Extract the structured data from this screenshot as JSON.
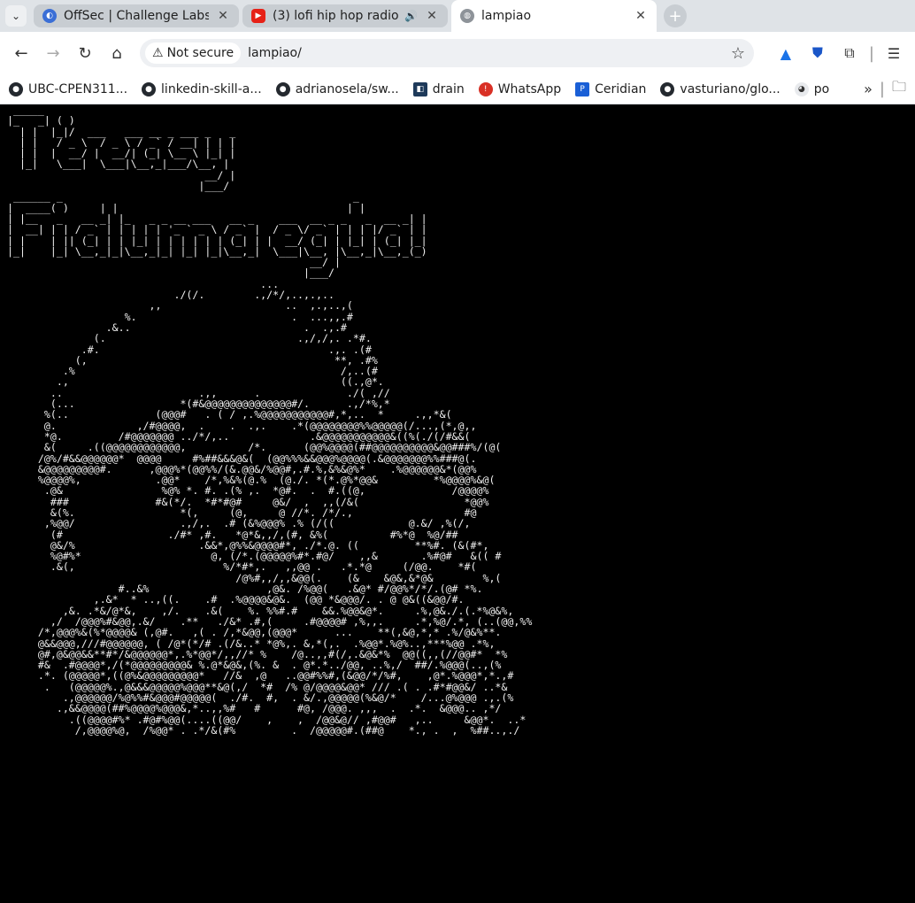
{
  "browser": {
    "tabs": [
      {
        "title": "OffSec | Challenge Labs",
        "active": false
      },
      {
        "title": "(3) lofi hip hop radio 📚",
        "active": false
      },
      {
        "title": "lampiao",
        "active": true
      }
    ],
    "address": {
      "security_label": "Not secure",
      "url": "lampiao/"
    },
    "bookmarks": [
      {
        "label": "UBC-CPEN311..."
      },
      {
        "label": "linkedin-skill-a..."
      },
      {
        "label": "adrianosela/sw..."
      },
      {
        "label": "drain"
      },
      {
        "label": "WhatsApp"
      },
      {
        "label": "Ceridian"
      },
      {
        "label": "vasturiano/glo..."
      },
      {
        "label": "po"
      }
    ]
  },
  "page": {
    "ascii_art": " _____                      \n|_   _| ( )                  \n  | |  |_|/  ___   ___ __ _ ___ _   _\n  | |   / _ \\  / _ \\ / _` / __| | | |\n  | |  |  __/ |  __/| (_| \\__ \\ |_| |\n  |_|   \\___|  \\___|\\__,_|___/\\__, |\n                                __/ |\n                               |___/ \n ______ _                                               _ \n|  ____( )     | |                                     | |\n| |__   _   __ _| |_   _ _ __ ___   __ _    ___  __ _ _   _  __ _| |\n|  __| | | / _` | | | | | '_ ` _ \\ / _` |  / _ \\/ _` | | | |/ _` | |\n| |    | || (_| | | |_| | | | | | | (_| | |  __/ (_| | |_| | (_| |_|\n|_|    |_| \\__,_|_|\\__,_|_| |_| |_|\\__,_|  \\___|\\__, |\\__,_|\\__,_(_)\n                                                 __/ |\n                                                |___/ \n                                         ...\n                           ./(/.        .,/*/,..,.,..\n                       ,,                    ..  ,.,..,(\n                   %.                         .  ...,,.#\n                .&..                            .  .,.#\n              (.                               .,/,/,. .*#.\n            .#.                                     .,. .(#\n           (,                                        **, .#%\n         .%                                           /,..(#\n        .,                                            ((.,@*.\n       ..                      .,,      .              ./( ,//\n       (...                 *(#&@@@@@@@@@@@@@@#/.      .,/*%,*\n      %(..              (@@@#   . ( / ,.%@@@@@@@@@@@#,*,..  *     .,,*&(\n      @.             ,/#@@@@,  .    .  .,.    .*(@@@@@@@@%%@@@@@(/...,(*,@,,\n      *@.         /#@@@@@@@ ../*/,..             .&@@@@@@@@@@@&((%(./(/#&&(\n      &(     .((@@@@@@@@@@@@,          /*.      (@@%@@@@(##@@@@@@@@@@&@@###%/(@(\n     /@%/#&&@@@@@@*  @@@@     #%##&&&@&(  (@@%%%&&@@@%@@@@(.&@@@@@@@%%###@(.\n     &@@@@@@@@@#.      ,@@@%*(@@%%/(&.@@&/%@@#,.#.%,&%&@%*    .%@@@@@@&*(@@%\n     %@@@@%,            .@@*    /*,%&%(@.%  (@./. *(*.@%*@@&         *%@@@@%&@(\n      .@&                %@% *. #. .(% ,.  *@#.  .  #.((@,              /@@@@%\n       ###              #&(*/.  *#*#@#     @&/  ,  ,,(/&(                 *@@%\n       &(%.                 *(,     (@,     @ //*. /*/.,                  #@\n      ,%@@/                 .,/,.  .# (&%@@@% .% (/((            @.&/ ,%(/,\n       (#                 ./#* ,#.   *@*&,,/,(#, &%(          #%*@  %@/##\n       @&/%                    .&&*,@%%&@@@@#*, ./*.@. ((         **%#. (&(#*,\n       %@#%*                     @, (/*.(@@@@@%#*.#@/    ,,&       .%#@#   &(( #\n       .&(,                        %/*#*,.   ,,@@ .   .*.*@     (/@@.    *#(\n                                     /@%#,,/,,&@@(.    (&    &@&,&*@&        %,(\n                  #..&%                   ,@&. /%@@(   .&@* #/@@%*/*/.(@# *%.\n              ,.&*  * ..,((.    .#  .%@@@@&@&.  (@@ *&@@@/. . @ @&((&@@/#.\n         ,&. .*&/@*&,    ,/.    .&(    %. %%#.#    &&.%@@&@*.     .%,@&./.(.*%@&%,\n       ,/  /@@@%#&@@,.&/    .**   ./&* .#,(     .#@@@@# ,%,,.     .*,%@/.*, (..(@@,%%\n     /*,@@@%&(%*@@@@& (,@#.   ,( . /,*&@@,(@@@*      ...    **(,&@,*,* .%/@&%**.\n     @&&@@@,///#@@@@@@, ( /@*(*/# .(/&..* *@%,. &,*(,.  .%@@*.%@%..,***%@@ .*%,\n     @#,@&@@&&**#*/&@@@@@@*,.%*@@*/,,//* %    /@..,,#(/,.&@&*%  @@((,,(//@@#*  *%\n     #&  .#@@@@*,/(*@@@@@@@@@& %.@*&@&,(%. &  . @*.*../@@, ..%,/  ##/.%@@@(..,(%\n     .*. (@@@@@*,((@%&@@@@@@@@@*   //&  ,@   ..@@#%%#,(&@@/*/%#,    ,@*.%@@@*,*.,#\n      .   (@@@@@%.,@&&&@@@@@%@@@**&@(,/  *#  /% @/@@@@&@@* /// .( . .#*#@@&/ ..*&\n         .,@@@@@@/%@%%#&@@@#@@@@@(  ./#.  #,  . &/.,@@@@@(%&@/*    /...@%@@@ .,.(%\n        .,&&@@@@(##%@@@@%@@@&,*..,,%#   #      #@, /@@@. ,,,  .  .*.  &@@@.. ,*/\n          .((@@@@#%* .#@#%@@(....((@@/    ,    ,  /@@&@// ,#@@#   ,..     &@@*.  ..*\n           /,@@@@%@,  /%@@* . .*/&(#%         .  /@@@@@#.(##@    *., .  ,  %##..,./"
  }
}
